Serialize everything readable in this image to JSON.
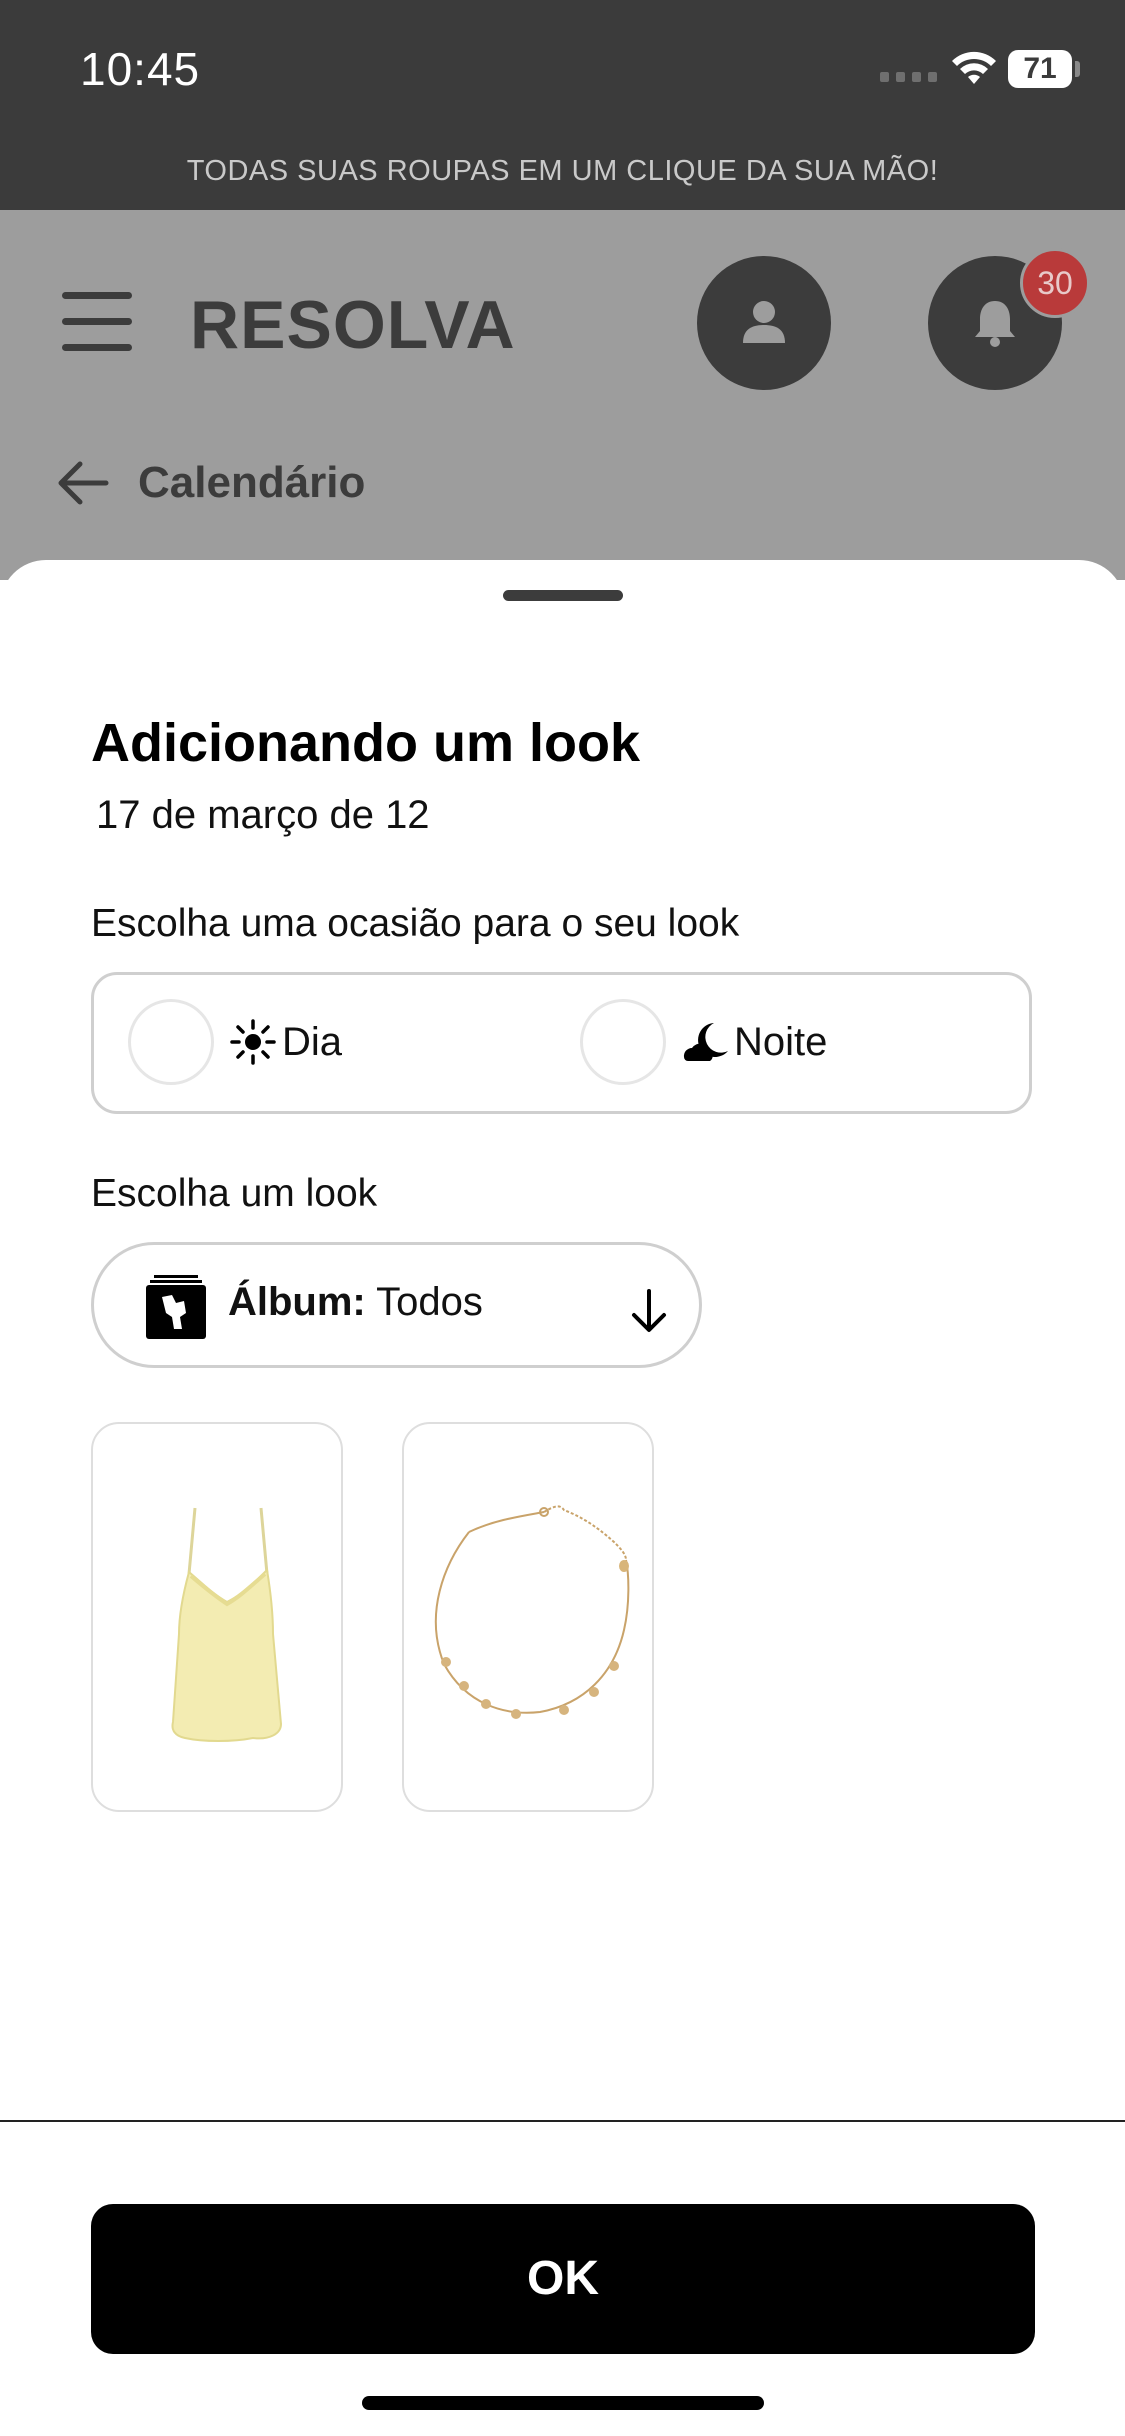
{
  "status_bar": {
    "time": "10:45",
    "battery": "71"
  },
  "promo_banner": "TODAS SUAS ROUPAS EM UM CLIQUE DA SUA MÃO!",
  "header": {
    "brand": "RESOLVA",
    "notification_count": "30",
    "back_label": "Calendário"
  },
  "sheet": {
    "title": "Adicionando um look",
    "date": "17 de março de 12",
    "occasion_label": "Escolha uma ocasião para o seu look",
    "occasions": [
      {
        "label": "Dia",
        "icon": "sun-icon",
        "selected": false
      },
      {
        "label": "Noite",
        "icon": "cloud-moon-icon",
        "selected": false
      }
    ],
    "look_label": "Escolha um look",
    "album": {
      "key": "Álbum:",
      "value": "Todos"
    },
    "looks": [
      {
        "item": "yellow-camisole-top"
      },
      {
        "item": "gold-necklace"
      }
    ],
    "ok_label": "OK"
  },
  "colors": {
    "status_bar": "#3b3b3b",
    "dimmed_header": "#9d9d9d",
    "badge": "#b93a3a",
    "primary_button": "#000000"
  }
}
